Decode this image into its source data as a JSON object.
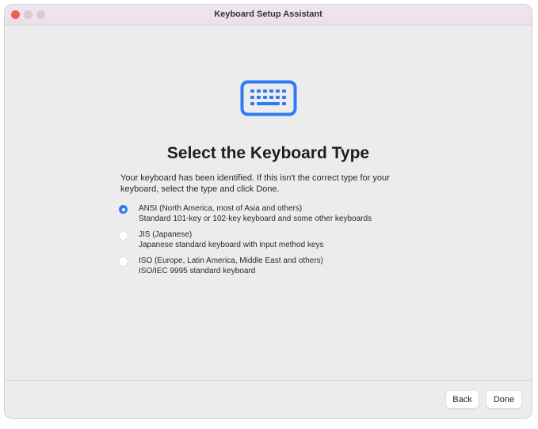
{
  "window": {
    "title": "Keyboard Setup Assistant"
  },
  "icon": "keyboard-icon",
  "accent": "#2f7bf5",
  "heading": "Select the Keyboard Type",
  "intro_line1": "Your keyboard has been identified. If this isn't the correct type for your",
  "intro_line2": "keyboard, select the type and click Done.",
  "options": [
    {
      "label": "ANSI (North America, most of Asia and others)",
      "desc": "Standard 101-key or 102-key keyboard and some other keyboards",
      "selected": true
    },
    {
      "label": "JIS (Japanese)",
      "desc": "Japanese standard keyboard with input method keys",
      "selected": false
    },
    {
      "label": "ISO (Europe, Latin America, Middle East and others)",
      "desc": "ISO/IEC 9995 standard keyboard",
      "selected": false
    }
  ],
  "buttons": {
    "back": "Back",
    "done": "Done"
  }
}
